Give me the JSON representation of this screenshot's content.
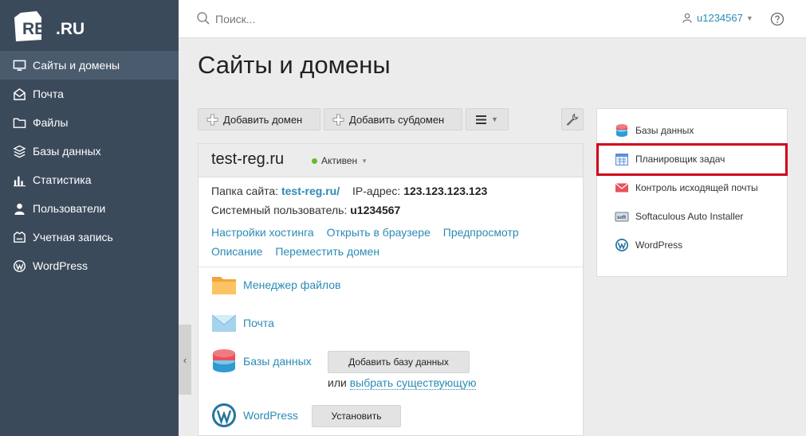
{
  "brand": {
    "logo_text": "REG.RU"
  },
  "sidebar": {
    "items": [
      {
        "label": "Сайты и домены",
        "icon": "monitor-icon",
        "active": true
      },
      {
        "label": "Почта",
        "icon": "mail-icon"
      },
      {
        "label": "Файлы",
        "icon": "folder-icon"
      },
      {
        "label": "Базы данных",
        "icon": "database-icon"
      },
      {
        "label": "Статистика",
        "icon": "bar-chart-icon"
      },
      {
        "label": "Пользователи",
        "icon": "user-icon"
      },
      {
        "label": "Учетная запись",
        "icon": "shield-icon"
      },
      {
        "label": "WordPress",
        "icon": "wordpress-icon"
      }
    ]
  },
  "topbar": {
    "search_placeholder": "Поиск...",
    "username": "u1234567"
  },
  "page": {
    "title": "Сайты и домены"
  },
  "toolbar": {
    "add_domain": "Добавить домен",
    "add_subdomain": "Добавить субдомен"
  },
  "domain": {
    "name": "test-reg.ru",
    "status": "Активен",
    "folder_label": "Папка сайта:",
    "folder_value": "test-reg.ru/",
    "ip_label": "IP-адрес:",
    "ip_value": "123.123.123.123",
    "sysuser_label": "Системный пользователь:",
    "sysuser_value": "u1234567",
    "links_row1": [
      "Настройки хостинга",
      "Открыть в браузере",
      "Предпросмотр"
    ],
    "links_row2": [
      "Описание",
      "Переместить домен"
    ],
    "apps": {
      "file_manager": "Менеджер файлов",
      "mail": "Почта",
      "databases": "Базы данных",
      "add_db_button": "Добавить базу данных",
      "or_text": "или",
      "choose_existing": "выбрать существующую",
      "wordpress": "WordPress",
      "install_button": "Установить"
    }
  },
  "right_panel": {
    "items": [
      {
        "label": "Базы данных",
        "icon": "database-icon"
      },
      {
        "label": "Планировщик задач",
        "icon": "calendar-icon",
        "highlighted": true
      },
      {
        "label": "Контроль исходящей почты",
        "icon": "mail-icon"
      },
      {
        "label": "Softaculous Auto Installer",
        "icon": "softaculous-icon"
      },
      {
        "label": "WordPress",
        "icon": "wordpress-icon"
      }
    ]
  },
  "colors": {
    "sidebar_bg": "#3b4a5b",
    "link": "#2a8bb5",
    "status_active": "#6ab82d",
    "highlight": "#d0021b"
  }
}
